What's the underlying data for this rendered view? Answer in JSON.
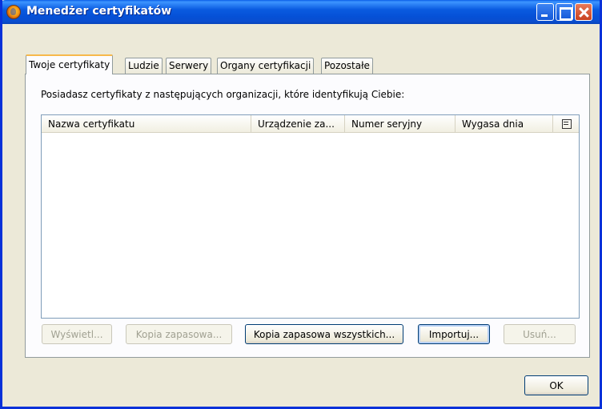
{
  "window": {
    "title": "Menedżer certyfikatów"
  },
  "tabs": [
    {
      "label": "Twoje certyfikaty",
      "active": true
    },
    {
      "label": "Ludzie",
      "active": false
    },
    {
      "label": "Serwery",
      "active": false
    },
    {
      "label": "Organy certyfikacji",
      "active": false
    },
    {
      "label": "Pozostałe",
      "active": false
    }
  ],
  "panel": {
    "description": "Posiadasz certyfikaty z następujących organizacji, które identyfikują Ciebie:",
    "columns": [
      "Nazwa certyfikatu",
      "Urządzenie za...",
      "Numer seryjny",
      "Wygasa dnia"
    ],
    "rows": []
  },
  "buttons": {
    "view": "Wyświetl...",
    "backup": "Kopia zapasowa...",
    "backup_all": "Kopia zapasowa wszystkich...",
    "import": "Importuj...",
    "delete": "Usuń...",
    "ok": "OK"
  },
  "icons": {
    "app": "firefox-icon",
    "column_picker": "column-picker-icon"
  }
}
